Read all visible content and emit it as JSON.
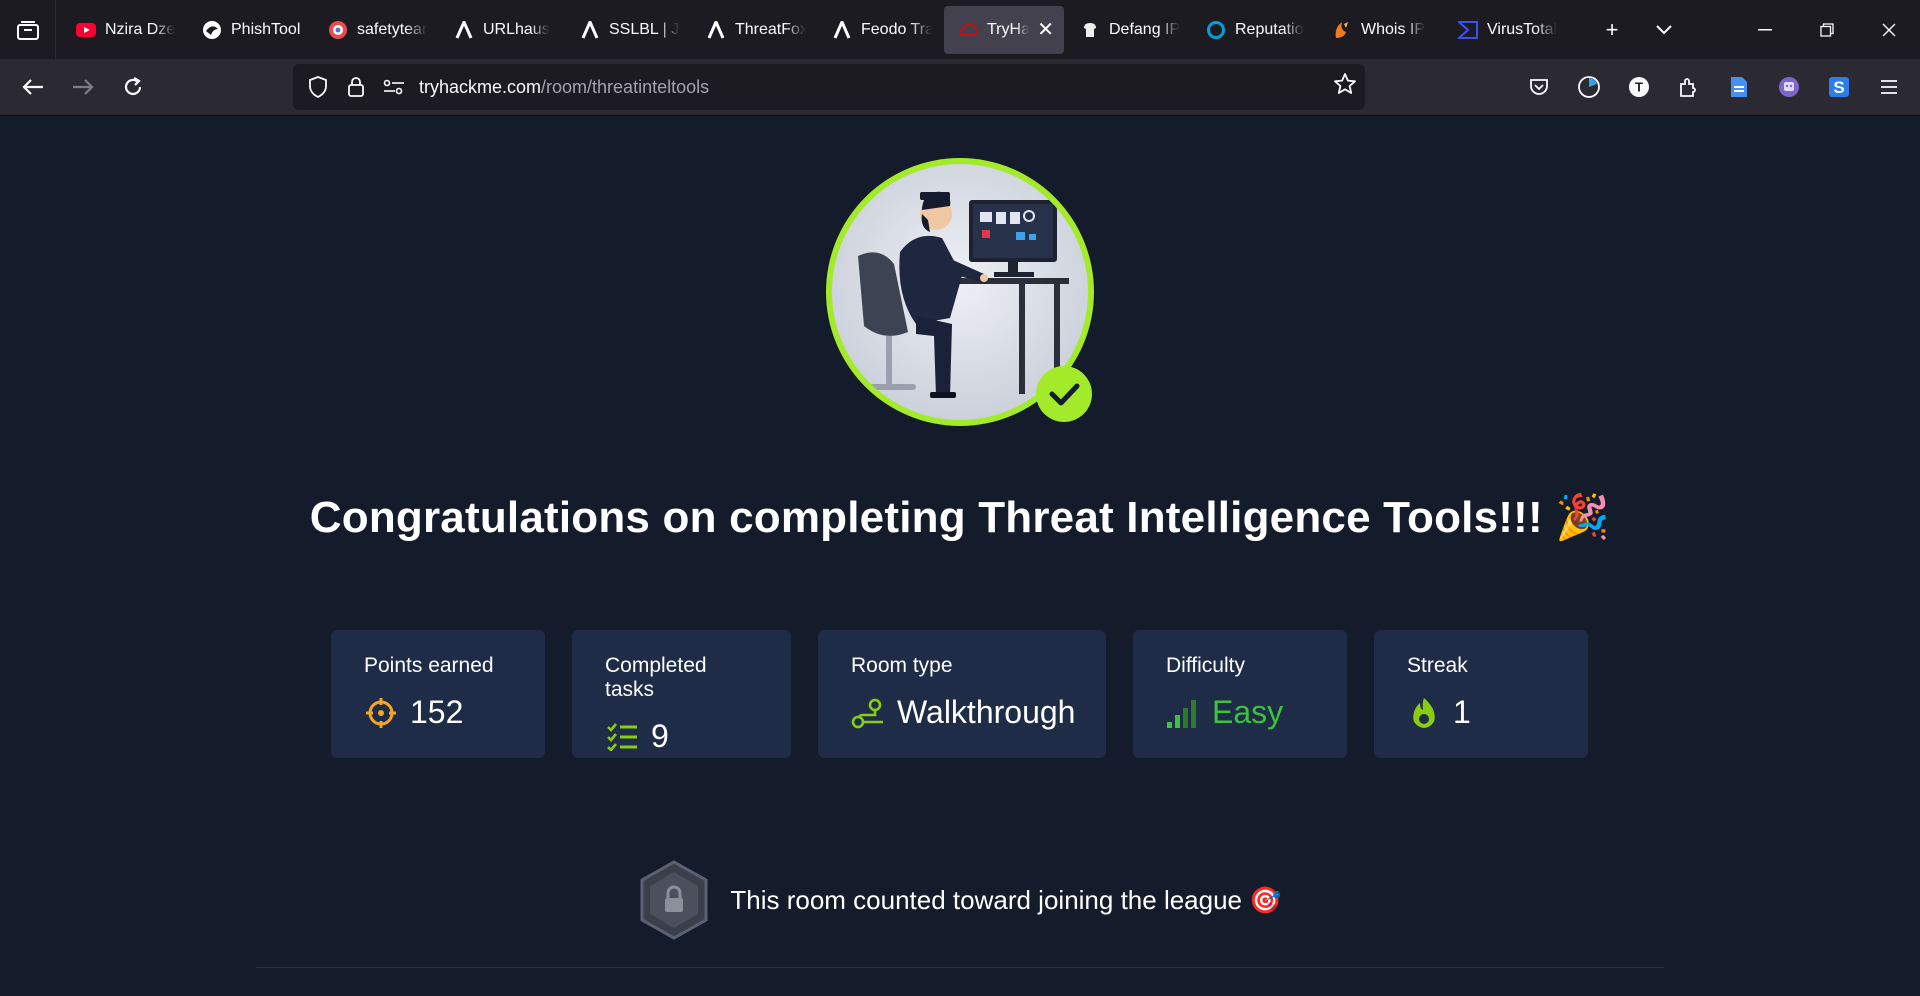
{
  "browser": {
    "tabs": [
      {
        "title": "Nzira Dze",
        "icon": "youtube-icon",
        "color": "#ff0033"
      },
      {
        "title": "PhishTool",
        "icon": "phishtool-icon",
        "color": "#ffffff"
      },
      {
        "title": "safetytear",
        "icon": "safetytear-icon",
        "color": "#e84d4d"
      },
      {
        "title": "URLhaus",
        "icon": "abuse-ch-icon",
        "color": "#ffffff"
      },
      {
        "title": "SSLBL | JA",
        "icon": "abuse-ch-icon",
        "color": "#ffffff"
      },
      {
        "title": "ThreatFox",
        "icon": "abuse-ch-icon",
        "color": "#ffffff"
      },
      {
        "title": "Feodo Tra",
        "icon": "abuse-ch-icon",
        "color": "#ffffff"
      },
      {
        "title": "TryHac",
        "icon": "tryhackme-icon",
        "color": "#c11111",
        "active": true
      },
      {
        "title": "Defang IP",
        "icon": "cyberchef-icon",
        "color": "#ffffff"
      },
      {
        "title": "Reputatio",
        "icon": "talos-icon",
        "color": "#049fd9"
      },
      {
        "title": "Whois IP",
        "icon": "whois-icon",
        "color": "#f07b1e"
      },
      {
        "title": "VirusTotal",
        "icon": "virustotal-icon",
        "color": "#394eff"
      }
    ],
    "url_host": "tryhackme.com",
    "url_path": "/room/threatinteltools"
  },
  "page": {
    "headline": "Congratulations on completing Threat Intelligence Tools!!! 🎉",
    "stats": [
      {
        "label": "Points earned",
        "value": "152",
        "icon": "target-icon",
        "color": "#f5a623"
      },
      {
        "label": "Completed tasks",
        "value": "9",
        "icon": "task-list-icon",
        "color": "#88cc14"
      },
      {
        "label": "Room type",
        "value": "Walkthrough",
        "icon": "route-icon",
        "color": "#88cc14"
      },
      {
        "label": "Difficulty",
        "value": "Easy",
        "icon": "signal-bars-icon",
        "color": "#3bc33b"
      },
      {
        "label": "Streak",
        "value": "1",
        "icon": "flame-icon",
        "color": "#88cc14"
      }
    ],
    "league_text": "This room counted toward joining the league 🎯"
  },
  "colors": {
    "accent": "#a3ea2a",
    "card_bg": "#1f2c47",
    "page_bg": "#141b2a"
  }
}
